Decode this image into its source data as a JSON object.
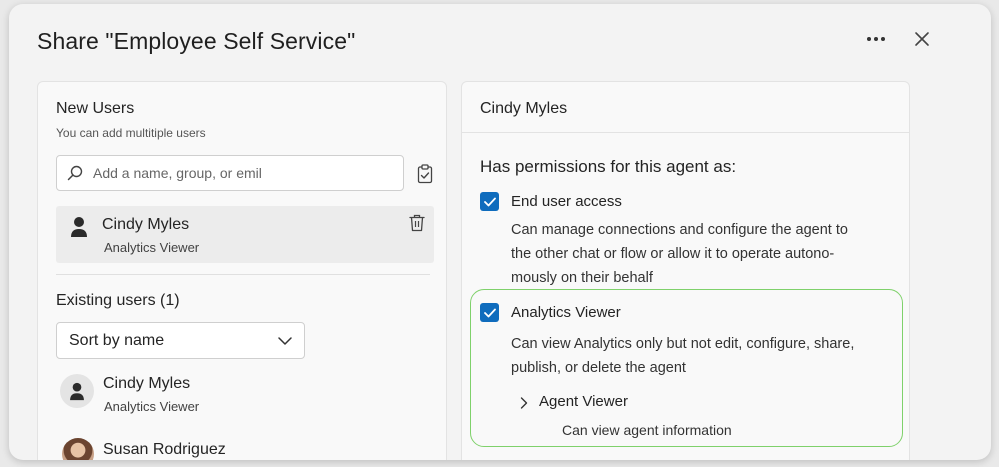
{
  "dialog": {
    "title": "Share \"Employee Self Service\"",
    "more_icon": "more-horizontal-icon",
    "close_icon": "close-icon"
  },
  "left_panel": {
    "heading": "New Users",
    "subtext": "You can add multitiple users",
    "search": {
      "placeholder": "Add a name, group, or emil",
      "value": ""
    },
    "new_users": [
      {
        "name": "Cindy Myles",
        "role": "Analytics Viewer"
      }
    ],
    "existing_heading": "Existing users (1)",
    "sort": {
      "selected": "Sort by name"
    },
    "existing_users": [
      {
        "name": "Cindy Myles",
        "role": "Analytics Viewer"
      },
      {
        "name": "Susan Rodriguez",
        "role": ""
      }
    ]
  },
  "right_panel": {
    "user_name": "Cindy Myles",
    "permissions_heading": "Has permissions for this agent as:",
    "permissions": [
      {
        "title": "End user access",
        "checked": true,
        "description_lines": [
          "Can manage connections and configure the agent to",
          "the other chat or flow or allow it to operate autono-",
          "mously on their behalf"
        ]
      },
      {
        "title": "Analytics Viewer",
        "checked": true,
        "highlighted": true,
        "description_lines": [
          "Can view Analytics only but not edit, configure, share,",
          "publish, or delete the agent"
        ],
        "sub_permission": {
          "title": "Agent Viewer",
          "description": "Can view agent information"
        }
      }
    ]
  },
  "colors": {
    "accent": "#0f6cbd",
    "highlight_border": "#7fd16b",
    "dialog_bg": "#f3f3f3",
    "panel_bg": "#f9f9f9"
  }
}
